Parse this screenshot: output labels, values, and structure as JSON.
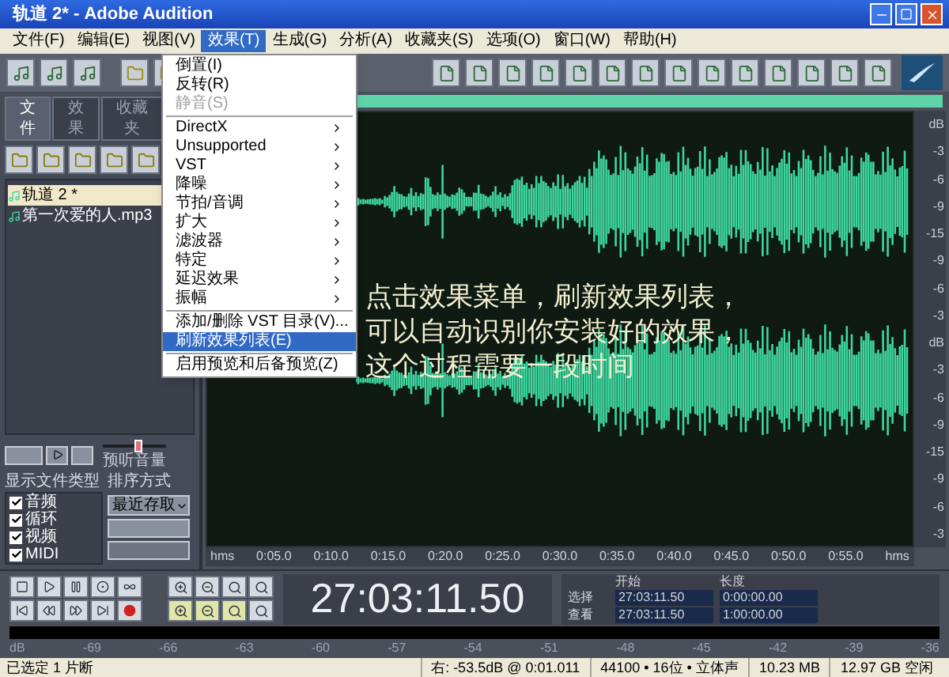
{
  "window": {
    "title": "轨道 2* - Adobe Audition"
  },
  "menu": [
    {
      "label": "文件(F)",
      "selected": false
    },
    {
      "label": "编辑(E)",
      "selected": false
    },
    {
      "label": "视图(V)",
      "selected": false
    },
    {
      "label": "效果(T)",
      "selected": true
    },
    {
      "label": "生成(G)",
      "selected": false
    },
    {
      "label": "分析(A)",
      "selected": false
    },
    {
      "label": "收藏夹(S)",
      "selected": false
    },
    {
      "label": "选项(O)",
      "selected": false
    },
    {
      "label": "窗口(W)",
      "selected": false
    },
    {
      "label": "帮助(H)",
      "selected": false
    }
  ],
  "effects_menu": [
    {
      "kind": "item",
      "label": "倒置(I)",
      "disabled": false,
      "selected": false
    },
    {
      "kind": "item",
      "label": "反转(R)",
      "disabled": false,
      "selected": false
    },
    {
      "kind": "item",
      "label": "静音(S)",
      "disabled": true,
      "selected": false
    },
    {
      "kind": "separator"
    },
    {
      "kind": "submenu",
      "label": "DirectX",
      "disabled": false,
      "selected": false
    },
    {
      "kind": "submenu",
      "label": "Unsupported",
      "disabled": false,
      "selected": false
    },
    {
      "kind": "submenu",
      "label": "VST",
      "disabled": false,
      "selected": false
    },
    {
      "kind": "submenu",
      "label": "降噪",
      "disabled": false,
      "selected": false
    },
    {
      "kind": "submenu",
      "label": "节拍/音调",
      "disabled": false,
      "selected": false
    },
    {
      "kind": "submenu",
      "label": "扩大",
      "disabled": false,
      "selected": false
    },
    {
      "kind": "submenu",
      "label": "滤波器",
      "disabled": false,
      "selected": false
    },
    {
      "kind": "submenu",
      "label": "特定",
      "disabled": false,
      "selected": false
    },
    {
      "kind": "submenu",
      "label": "延迟效果",
      "disabled": false,
      "selected": false
    },
    {
      "kind": "submenu",
      "label": "振幅",
      "disabled": false,
      "selected": false
    },
    {
      "kind": "separator"
    },
    {
      "kind": "item",
      "label": "添加/删除 VST 目录(V)...",
      "disabled": false,
      "selected": false
    },
    {
      "kind": "item",
      "label": "刷新效果列表(E)",
      "disabled": false,
      "selected": true
    },
    {
      "kind": "separator"
    },
    {
      "kind": "item",
      "label": "启用预览和后备预览(Z)",
      "disabled": false,
      "selected": false
    }
  ],
  "file_panel": {
    "tabs": [
      {
        "label": "文件",
        "selected": true
      },
      {
        "label": "效果",
        "selected": false
      },
      {
        "label": "收藏夹",
        "selected": false
      }
    ],
    "files": [
      {
        "label": "轨道 2 *",
        "selected": true
      },
      {
        "label": "第一次爱的人.mp3",
        "selected": false
      }
    ],
    "volume": {
      "label": "预听音量",
      "level": 0.55
    },
    "show_types_label": "显示文件类型",
    "types": [
      {
        "label": "音频",
        "checked": true
      },
      {
        "label": "循环",
        "checked": true
      },
      {
        "label": "视频",
        "checked": true
      },
      {
        "label": "MIDI",
        "checked": true
      }
    ],
    "sort_label": "排序方式",
    "sort_value": "最近存取"
  },
  "waveform": {
    "annotation": [
      "点击效果菜单，刷新效果列表，",
      "可以自动识别你安装好的效果，",
      "这个过程需要一段时间"
    ],
    "db_scales": [
      [
        "dB",
        "-3",
        "-6",
        "-9",
        "-15",
        "-9",
        "-6",
        "-3"
      ],
      [
        "dB",
        "-3",
        "-6",
        "-9",
        "-15",
        "-9",
        "-6",
        "-3"
      ]
    ],
    "ruler": [
      "hms",
      "0:05.0",
      "0:10.0",
      "0:15.0",
      "0:20.0",
      "0:25.0",
      "0:30.0",
      "0:35.0",
      "0:40.0",
      "0:45.0",
      "0:50.0",
      "0:55.0",
      "hms"
    ]
  },
  "time_display": "27:03:11.50",
  "selection_panel": {
    "headers": [
      "开始",
      "长度"
    ],
    "rows": [
      {
        "label": "选择",
        "start": "27:03:11.50",
        "length": "0:00:00.00"
      },
      {
        "label": "查看",
        "start": "27:03:11.50",
        "length": "1:00:00.00"
      }
    ]
  },
  "meter_ticks": [
    "dB",
    "-69",
    "-66",
    "-63",
    "-60",
    "-57",
    "-54",
    "-51",
    "-48",
    "-45",
    "-42",
    "-39",
    "-36"
  ],
  "status_bar": {
    "left": "已选定 1 片断",
    "fields": [
      "右: -53.5dB @ 0:01.011",
      "44100 • 16位 • 立体声",
      "10.23 MB",
      "12.97 GB 空闲"
    ]
  }
}
